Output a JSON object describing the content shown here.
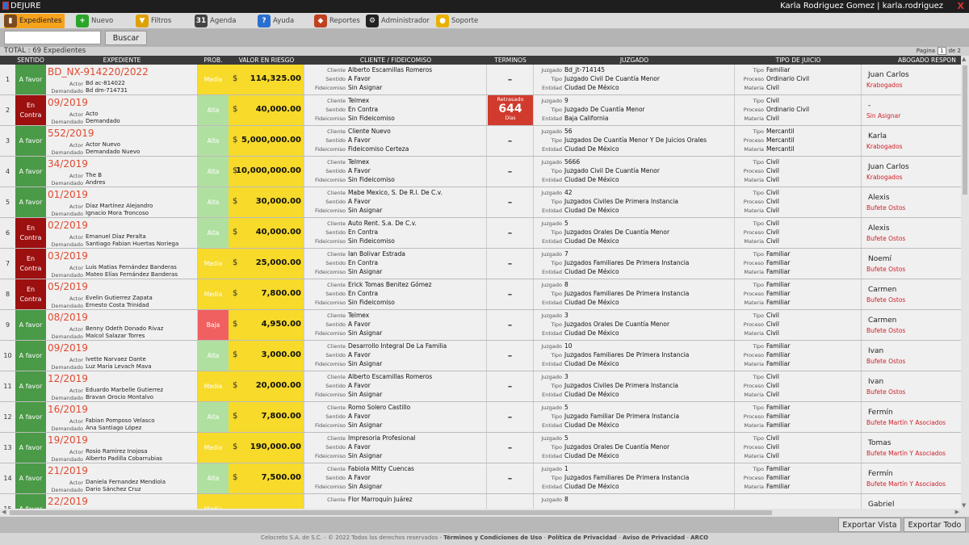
{
  "titlebar": {
    "app": "DEJURE",
    "user": "Karla Rodriguez Gomez  |  karla.rodriguez",
    "close": "X"
  },
  "toolbar": [
    {
      "label": "Expedientes",
      "icon": "folder-icon",
      "color": "#7a4a20",
      "glyph": "▮",
      "active": true
    },
    {
      "label": "Nuevo",
      "icon": "plus-icon",
      "color": "#2aa52a",
      "glyph": "+"
    },
    {
      "label": "Filtros",
      "icon": "funnel-icon",
      "color": "#e0a000",
      "glyph": "▼"
    },
    {
      "label": "Agenda",
      "icon": "calendar-icon",
      "color": "#444444",
      "glyph": "31"
    },
    {
      "label": "Ayuda",
      "icon": "help-icon",
      "color": "#2a6fd0",
      "glyph": "?"
    },
    {
      "label": "Reportes",
      "icon": "reports-icon",
      "color": "#c04020",
      "glyph": "◆"
    },
    {
      "label": "Administrador",
      "icon": "admin-icon",
      "color": "#222222",
      "glyph": "⚙"
    },
    {
      "label": "Soporte",
      "icon": "support-icon",
      "color": "#e8b000",
      "glyph": "●"
    }
  ],
  "search": {
    "button": "Buscar",
    "value": ""
  },
  "total": "TOTAL : 69 Expedientes",
  "pagination": {
    "label": "Pagina",
    "page": "1",
    "of": "de 2"
  },
  "columns": [
    "SENTIDO",
    "EXPEDIENTE",
    "PROB.",
    "VALOR EN RIESGO",
    "CLIENTE / FIDEICOMISO",
    "TERMINOS",
    "JUZGADO",
    "TIPO DE JUICIO",
    "ABOGADO RESPON"
  ],
  "labels": {
    "actor": "Actor",
    "demandado": "Demandado",
    "cliente": "Cliente",
    "sentido": "Sentido",
    "fideicomiso": "Fideicomiso",
    "juzgado": "Juzgado",
    "tipo": "Tipo",
    "entidad": "Entidad",
    "proceso": "Proceso",
    "materia": "Materia",
    "currency": "$",
    "dash": "–"
  },
  "rows": [
    {
      "n": "1",
      "sentido": "A favor",
      "s": "favor",
      "exp": "BD_NX-914220/2022",
      "actor": "Bd  ac-814022",
      "dem": "Bd  dm-714731",
      "prob": "Media",
      "p": "media",
      "valor": "114,325.00",
      "cliente": "Alberto Escamillas Romeros",
      "csent": "A Favor",
      "fid": "Sin Asignar",
      "ter": "",
      "jz": "Bd_jt-714145",
      "jt": "Juzgado Civil De Cuantía Menor",
      "je": "Ciudad De México",
      "tt": "Familiar",
      "tp": "Ordinario Civil",
      "tm": "Civil",
      "abo": "Juan Carlos",
      "firm": "Krabogados"
    },
    {
      "n": "2",
      "sentido": "En Contra",
      "s": "contra",
      "exp": "09/2019",
      "actor": "Acto",
      "dem": "Demandado",
      "prob": "Alta",
      "p": "alta",
      "valor": "40,000.00",
      "cliente": "Telmex",
      "csent": "En Contra",
      "fid": "Sin Fideicomiso",
      "ter": "late",
      "jz": "9",
      "jt": "Juzgado De Cuantía Menor",
      "je": "Baja California",
      "tt": "Civil",
      "tp": "Ordinario Civil",
      "tm": "Civil",
      "abo": "-",
      "firm": "Sin Asignar"
    },
    {
      "n": "3",
      "sentido": "A favor",
      "s": "favor",
      "exp": "552/2019",
      "actor": "Actor Nuevo",
      "dem": "Demandado Nuevo",
      "prob": "Alta",
      "p": "alta",
      "valor": "5,000,000.00",
      "cliente": "Cliente Nuevo",
      "csent": "A Favor",
      "fid": "Fideicomiso Certeza",
      "ter": "",
      "jz": "56",
      "jt": "Juzgados De Cuantía Menor Y De Juicios Orales",
      "je": "Ciudad De México",
      "tt": "Mercantil",
      "tp": "Mercantil",
      "tm": "Mercantil",
      "abo": "Karla",
      "firm": "Krabogados"
    },
    {
      "n": "4",
      "sentido": "A favor",
      "s": "favor",
      "exp": "34/2019",
      "actor": "The B",
      "dem": "Andres",
      "prob": "Alta",
      "p": "alta",
      "valor": "10,000,000.00",
      "cliente": "Telmex",
      "csent": "A Favor",
      "fid": "Sin Fideicomiso",
      "ter": "",
      "jz": "5666",
      "jt": "Juzgado Civil De Cuantía Menor",
      "je": "Ciudad De México",
      "tt": "Civil",
      "tp": "Civil",
      "tm": "Civil",
      "abo": "Juan Carlos",
      "firm": "Krabogados"
    },
    {
      "n": "5",
      "sentido": "A favor",
      "s": "favor",
      "exp": "01/2019",
      "actor": "Díaz Martínez Alejandro",
      "dem": "Ignacio Mora Troncoso",
      "prob": "Alta",
      "p": "alta",
      "valor": "30,000.00",
      "cliente": "Mabe Mexico, S. De R.l. De C.v.",
      "csent": "A Favor",
      "fid": "Sin Asignar",
      "ter": "",
      "jz": "42",
      "jt": "Juzgados Civiles De Primera Instancia",
      "je": "Ciudad De México",
      "tt": "Civil",
      "tp": "Civil",
      "tm": "Civil",
      "abo": "Alexis",
      "firm": "Bufete Ostos"
    },
    {
      "n": "6",
      "sentido": "En Contra",
      "s": "contra",
      "exp": "02/2019",
      "actor": "Emanuel Díaz Peralta",
      "dem": "Santiago Fabian Huertas Noriega",
      "prob": "Alta",
      "p": "alta",
      "valor": "40,000.00",
      "cliente": "Auto Rent. S.a. De C.v.",
      "csent": "En Contra",
      "fid": "Sin Fideicomiso",
      "ter": "",
      "jz": "5",
      "jt": "Juzgados Orales De Cuantía Menor",
      "je": "Ciudad De México",
      "tt": "Civil",
      "tp": "Civil",
      "tm": "Civil",
      "abo": "Alexis",
      "firm": "Bufete Ostos"
    },
    {
      "n": "7",
      "sentido": "En Contra",
      "s": "contra",
      "exp": "03/2019",
      "actor": "Luis Matias Fernández Banderas",
      "dem": "Mateo Elías Fernández Banderas",
      "prob": "Media",
      "p": "media",
      "valor": "25,000.00",
      "cliente": "Ian Bolivar Estrada",
      "csent": "En Contra",
      "fid": "Sin Asignar",
      "ter": "",
      "jz": "7",
      "jt": "Juzgados Familiares De Primera Instancia",
      "je": "Ciudad De México",
      "tt": "Familiar",
      "tp": "Familiar",
      "tm": "Familiar",
      "abo": "Noemí",
      "firm": "Bufete Ostos"
    },
    {
      "n": "8",
      "sentido": "En Contra",
      "s": "contra",
      "exp": "05/2019",
      "actor": "Evelin Gutierrez Zapata",
      "dem": "Ernesto Costa Trinidad",
      "prob": "Media",
      "p": "media",
      "valor": "7,800.00",
      "cliente": "Erick Tomas Benitez Gómez",
      "csent": "En Contra",
      "fid": "Sin Fideicomiso",
      "ter": "",
      "jz": "8",
      "jt": "Juzgados Familiares De Primera Instancia",
      "je": "Ciudad De México",
      "tt": "Familiar",
      "tp": "Familiar",
      "tm": "Familiar",
      "abo": "Carmen",
      "firm": "Bufete Ostos"
    },
    {
      "n": "9",
      "sentido": "A favor",
      "s": "favor",
      "exp": "08/2019",
      "actor": "Benny Odeth Donado Rivaz",
      "dem": "Maicol Salazar Torres",
      "prob": "Baja",
      "p": "baja",
      "valor": "4,950.00",
      "cliente": "Telmex",
      "csent": "A Favor",
      "fid": "Sin Asignar",
      "ter": "",
      "jz": "3",
      "jt": "Juzgados Orales De Cuantía Menor",
      "je": "Ciudad De México",
      "tt": "Civil",
      "tp": "Civil",
      "tm": "Civil",
      "abo": "Carmen",
      "firm": "Bufete Ostos"
    },
    {
      "n": "10",
      "sentido": "A favor",
      "s": "favor",
      "exp": "09/2019",
      "actor": "Ivette Narvaez Dante",
      "dem": "Luz María Levach Mava",
      "prob": "Alta",
      "p": "alta",
      "valor": "3,000.00",
      "cliente": "Desarrollo Integral De La Familia",
      "csent": "A Favor",
      "fid": "Sin Asignar",
      "ter": "",
      "jz": "10",
      "jt": "Juzgados Familiares De Primera Instancia",
      "je": "Ciudad De México",
      "tt": "Familiar",
      "tp": "Familiar",
      "tm": "Familiar",
      "abo": "Ivan",
      "firm": "Bufete Ostos"
    },
    {
      "n": "11",
      "sentido": "A favor",
      "s": "favor",
      "exp": "12/2019",
      "actor": "Eduardo Marbelle Gutierrez",
      "dem": "Bravan Orocio Montalvo",
      "prob": "Media",
      "p": "media",
      "valor": "20,000.00",
      "cliente": "Alberto Escamillas Romeros",
      "csent": "A Favor",
      "fid": "Sin Asignar",
      "ter": "",
      "jz": "3",
      "jt": "Juzgados Civiles De Primera Instancia",
      "je": "Ciudad De México",
      "tt": "Civil",
      "tp": "Civil",
      "tm": "Civil",
      "abo": "Ivan",
      "firm": "Bufete Ostos"
    },
    {
      "n": "12",
      "sentido": "A favor",
      "s": "favor",
      "exp": "16/2019",
      "actor": "Fabian Pomposo Velasco",
      "dem": "Ana Santiago López",
      "prob": "Alta",
      "p": "alta",
      "valor": "7,800.00",
      "cliente": "Romo Solero Castillo",
      "csent": "A Favor",
      "fid": "Sin Asignar",
      "ter": "",
      "jz": "5",
      "jt": "Juzgado Familiar De Primera Instancia",
      "je": "Ciudad De México",
      "tt": "Familiar",
      "tp": "Familiar",
      "tm": "Familiar",
      "abo": "Fermín",
      "firm": "Bufete Martín Y Asociados"
    },
    {
      "n": "13",
      "sentido": "A favor",
      "s": "favor",
      "exp": "19/2019",
      "actor": "Rosio Ramirez Inojosa",
      "dem": "Alberto Padilla Cobarrubias",
      "prob": "Media",
      "p": "media",
      "valor": "190,000.00",
      "cliente": "Impresoria Profesional",
      "csent": "A Favor",
      "fid": "Sin Asignar",
      "ter": "",
      "jz": "5",
      "jt": "Juzgados Orales De Cuantía Menor",
      "je": "Ciudad De México",
      "tt": "Civil",
      "tp": "Civil",
      "tm": "Civil",
      "abo": "Tomas",
      "firm": "Bufete Martín Y Asociados"
    },
    {
      "n": "14",
      "sentido": "A favor",
      "s": "favor",
      "exp": "21/2019",
      "actor": "Daniela Fernandez Mendiola",
      "dem": "Dario Sánchez Cruz",
      "prob": "Alta",
      "p": "alta",
      "valor": "7,500.00",
      "cliente": "Fabiola Mitty Cuencas",
      "csent": "A Favor",
      "fid": "Sin Asignar",
      "ter": "",
      "jz": "1",
      "jt": "Juzgados Familiares De Primera Instancia",
      "je": "Ciudad De México",
      "tt": "Familiar",
      "tp": "Familiar",
      "tm": "Familiar",
      "abo": "Fermín",
      "firm": "Bufete Martín Y Asociados"
    },
    {
      "n": "15",
      "sentido": "A favor",
      "s": "favor",
      "exp": "22/2019",
      "actor": "",
      "dem": "",
      "prob": "Media",
      "p": "media",
      "valor": "",
      "cliente": "Flor Marroquín Juárez",
      "csent": "",
      "fid": "",
      "ter": "",
      "jz": "8",
      "jt": "",
      "je": "",
      "tt": "",
      "tp": "",
      "tm": "",
      "abo": "Gabriel",
      "firm": ""
    }
  ],
  "late": {
    "label": "Retrasado",
    "days": "644",
    "unit": "Días"
  },
  "buttons": {
    "export_view": "Exportar Vista",
    "export_all": "Exportar Todo"
  },
  "footer": {
    "text": "Celocreto S.A. de S.C. - © 2022 Todos los derechos reservados - ",
    "links": [
      "Términos y Condiciones de Uso",
      "Política de Privacidad",
      "Aviso de Privacidad",
      "ARCO"
    ]
  }
}
